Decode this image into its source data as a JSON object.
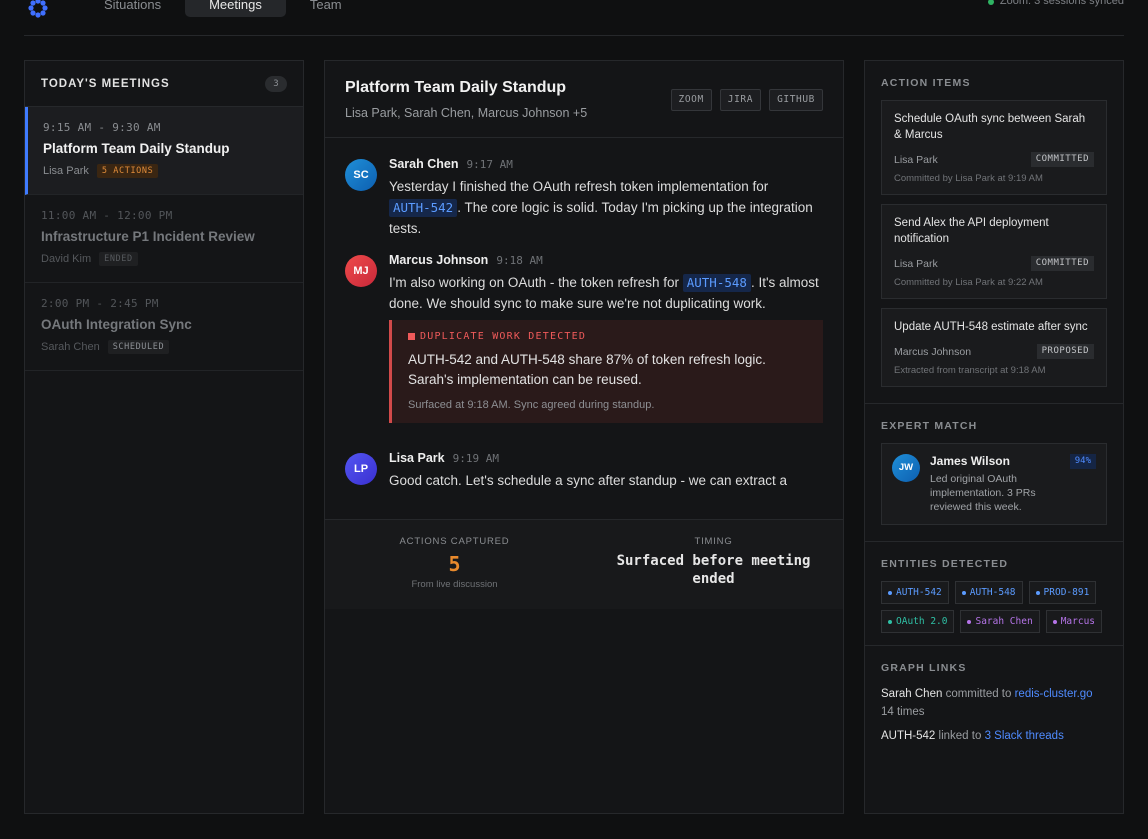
{
  "nav": {
    "tabs": [
      "Situations",
      "Meetings",
      "Team"
    ],
    "active": "Meetings",
    "sync_status": "Zoom: 3 sessions synced",
    "sync_color": "#2fb463"
  },
  "meetings_panel": {
    "title": "TODAY'S MEETINGS",
    "count": "3",
    "items": [
      {
        "time": "9:15 AM - 9:30 AM",
        "title": "Platform Team Daily Standup",
        "owner": "Lisa Park",
        "tag": "5 ACTIONS"
      },
      {
        "time": "11:00 AM - 12:00 PM",
        "title": "Infrastructure P1 Incident Review",
        "owner": "David Kim",
        "tag": "ENDED"
      },
      {
        "time": "2:00 PM - 2:45 PM",
        "title": "OAuth Integration Sync",
        "owner": "Sarah Chen",
        "tag": "SCHEDULED"
      }
    ]
  },
  "meeting": {
    "title": "Platform Team Daily Standup",
    "participants": "Lisa Park, Sarah Chen, Marcus Johnson +5",
    "integrations": [
      "ZOOM",
      "JIRA",
      "GITHUB"
    ]
  },
  "transcript": {
    "m1": {
      "initials": "SC",
      "name": "Sarah Chen",
      "time": "9:17 AM",
      "t1": "Yesterday I finished the OAuth refresh token implementation for ",
      "ticket": "AUTH-542",
      "t2": ". The core logic is solid. Today I'm picking up the integration tests."
    },
    "m2": {
      "initials": "MJ",
      "name": "Marcus Johnson",
      "time": "9:18 AM",
      "t1": "I'm also working on OAuth - the token refresh for ",
      "ticket": "AUTH-548",
      "t2": ". It's almost done. We should sync to make sure we're not duplicating work."
    },
    "alert": {
      "title": "DUPLICATE WORK DETECTED",
      "text": "AUTH-542 and AUTH-548 share 87% of token refresh logic. Sarah's implementation can be reused.",
      "foot": "Surfaced at 9:18 AM. Sync agreed during standup."
    },
    "m3": {
      "initials": "LP",
      "name": "Lisa Park",
      "time": "9:19 AM",
      "t1": "Good catch. Let's schedule a sync after standup - we can extract a"
    }
  },
  "stats": {
    "actions_label": "ACTIONS CAPTURED",
    "actions_value": "5",
    "actions_sub": "From live discussion",
    "timing_label": "TIMING",
    "timing_value": "Surfaced before meeting ended"
  },
  "action_items": {
    "title": "ACTION ITEMS",
    "items": [
      {
        "title": "Schedule OAuth sync between Sarah & Marcus",
        "owner": "Lisa Park",
        "status": "COMMITTED",
        "foot": "Committed by Lisa Park at 9:19 AM"
      },
      {
        "title": "Send Alex the API deployment notification",
        "owner": "Lisa Park",
        "status": "COMMITTED",
        "foot": "Committed by Lisa Park at 9:22 AM"
      },
      {
        "title": "Update AUTH-548 estimate after sync",
        "owner": "Marcus Johnson",
        "status": "PROPOSED",
        "foot": "Extracted from transcript at 9:18 AM"
      }
    ]
  },
  "expert_match": {
    "title": "EXPERT MATCH",
    "initials": "JW",
    "name": "James Wilson",
    "desc": "Led original OAuth implementation. 3 PRs reviewed this week.",
    "match": "94%"
  },
  "entities": {
    "title": "ENTITIES DETECTED",
    "items": [
      "AUTH-542",
      "AUTH-548",
      "PROD-891",
      "OAuth 2.0",
      "Sarah Chen",
      "Marcus"
    ]
  },
  "graph_links": {
    "title": "GRAPH LINKS",
    "l1": {
      "who": "Sarah Chen",
      "verb": " committed to ",
      "target": "redis-cluster.go",
      "tail": " 14 times"
    },
    "l2": {
      "who": "AUTH-542",
      "verb": " linked to ",
      "target": "3 Slack threads"
    }
  }
}
